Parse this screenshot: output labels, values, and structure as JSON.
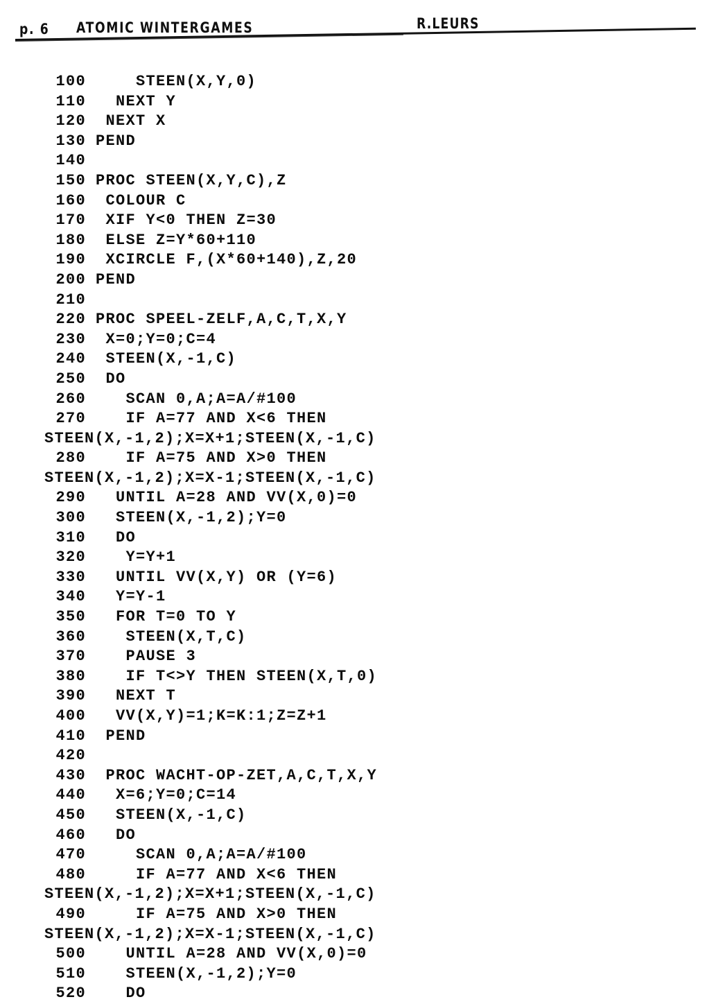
{
  "header": {
    "page_label": "p. 6",
    "title": "ATOMIC WINTERGAMES",
    "author": "R.LEURS"
  },
  "listing": {
    "lines": [
      {
        "no": "100",
        "code": "    STEEN(X,Y,0)"
      },
      {
        "no": "110",
        "code": "  NEXT Y"
      },
      {
        "no": "120",
        "code": " NEXT X"
      },
      {
        "no": "130",
        "code": "PEND"
      },
      {
        "no": "140",
        "code": ""
      },
      {
        "no": "150",
        "code": "PROC STEEN(X,Y,C),Z"
      },
      {
        "no": "160",
        "code": " COLOUR C"
      },
      {
        "no": "170",
        "code": " XIF Y<0 THEN Z=30"
      },
      {
        "no": "180",
        "code": " ELSE Z=Y*60+110"
      },
      {
        "no": "190",
        "code": " XCIRCLE F,(X*60+140),Z,20"
      },
      {
        "no": "200",
        "code": "PEND"
      },
      {
        "no": "210",
        "code": ""
      },
      {
        "no": "220",
        "code": "PROC SPEEL-ZELF,A,C,T,X,Y"
      },
      {
        "no": "230",
        "code": " X=0;Y=0;C=4"
      },
      {
        "no": "240",
        "code": " STEEN(X,-1,C)"
      },
      {
        "no": "250",
        "code": " DO"
      },
      {
        "no": "260",
        "code": "   SCAN 0,A;A=A/#100"
      },
      {
        "no": "270",
        "code": "   IF A=77 AND X<6 THEN"
      },
      {
        "no": "",
        "code": "STEEN(X,-1,2);X=X+1;STEEN(X,-1,C)",
        "continuation": true
      },
      {
        "no": "280",
        "code": "   IF A=75 AND X>0 THEN"
      },
      {
        "no": "",
        "code": "STEEN(X,-1,2);X=X-1;STEEN(X,-1,C)",
        "continuation": true
      },
      {
        "no": "290",
        "code": "  UNTIL A=28 AND VV(X,0)=0"
      },
      {
        "no": "300",
        "code": "  STEEN(X,-1,2);Y=0"
      },
      {
        "no": "310",
        "code": "  DO"
      },
      {
        "no": "320",
        "code": "   Y=Y+1"
      },
      {
        "no": "330",
        "code": "  UNTIL VV(X,Y) OR (Y=6)"
      },
      {
        "no": "340",
        "code": "  Y=Y-1"
      },
      {
        "no": "350",
        "code": "  FOR T=0 TO Y"
      },
      {
        "no": "360",
        "code": "   STEEN(X,T,C)"
      },
      {
        "no": "370",
        "code": "   PAUSE 3"
      },
      {
        "no": "380",
        "code": "   IF T<>Y THEN STEEN(X,T,0)"
      },
      {
        "no": "390",
        "code": "  NEXT T"
      },
      {
        "no": "400",
        "code": "  VV(X,Y)=1;K=K:1;Z=Z+1"
      },
      {
        "no": "410",
        "code": " PEND"
      },
      {
        "no": "420",
        "code": ""
      },
      {
        "no": "430",
        "code": " PROC WACHT-OP-ZET,A,C,T,X,Y"
      },
      {
        "no": "440",
        "code": "  X=6;Y=0;C=14"
      },
      {
        "no": "450",
        "code": "  STEEN(X,-1,C)"
      },
      {
        "no": "460",
        "code": "  DO"
      },
      {
        "no": "470",
        "code": "    SCAN 0,A;A=A/#100"
      },
      {
        "no": "480",
        "code": "    IF A=77 AND X<6 THEN"
      },
      {
        "no": "",
        "code": "STEEN(X,-1,2);X=X+1;STEEN(X,-1,C)",
        "continuation": true
      },
      {
        "no": "490",
        "code": "    IF A=75 AND X>0 THEN"
      },
      {
        "no": "",
        "code": "STEEN(X,-1,2);X=X-1;STEEN(X,-1,C)",
        "continuation": true
      },
      {
        "no": "500",
        "code": "   UNTIL A=28 AND VV(X,0)=0"
      },
      {
        "no": "510",
        "code": "   STEEN(X,-1,2);Y=0"
      },
      {
        "no": "520",
        "code": "   DO"
      }
    ]
  }
}
